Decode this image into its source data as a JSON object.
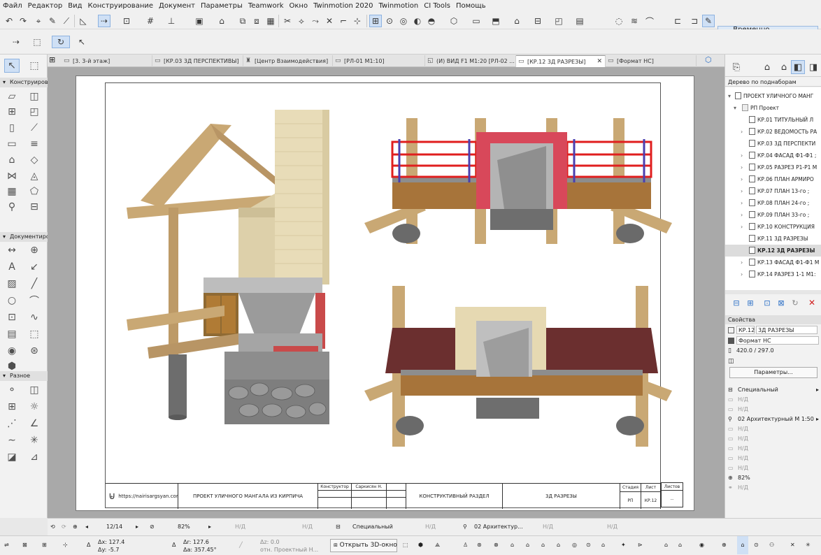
{
  "menu": [
    "Файл",
    "Редактор",
    "Вид",
    "Конструирование",
    "Документ",
    "Параметры",
    "Teamwork",
    "Окно",
    "Twinmotion 2020",
    "Twinmotion",
    "CI Tools",
    "Помощь"
  ],
  "toolbar": {
    "unlock_label": "Временно Разгруппировать"
  },
  "left_palette": {
    "section_construct": "Конструирова",
    "section_document": "Документиро",
    "section_misc": "Разное"
  },
  "tabs": [
    {
      "label": "[3. 3-й этаж]"
    },
    {
      "label": "[КР.03 3Д ПЕРСПЕКТИВЫ]"
    },
    {
      "label": "[Центр Взаимодействия]"
    },
    {
      "label": "[РЛ-01 М1:10]"
    },
    {
      "label": "(И) ВИД F1 М1:20 [РЛ-02 ..."
    },
    {
      "label": "[КР.12 3Д РАЗРЕЗЫ]",
      "close": "✕"
    },
    {
      "label": "[Формат НС]"
    }
  ],
  "title_block": {
    "site": "https://nairisargsyan.com",
    "project": "ПРОЕКТ УЛИЧНОГО МАНГАЛА ИЗ КИРПИЧА",
    "role": "Конструктор",
    "person": "Саркисян Н.",
    "section": "КОНСТРУКТИВНЫЙ РАЗДЕЛ",
    "sheet_title": "3Д РАЗРЕЗЫ",
    "stage_label": "Стадия",
    "stage_value": "РП",
    "sheet_label": "Лист",
    "sheet_value": "КР.12",
    "sheets_label": "Листов",
    "sheets_value": ".."
  },
  "right_panel": {
    "navigator_title": "Дерево по поднаборам",
    "tree": [
      {
        "label": "ПРОЕКТ УЛИЧНОГО МАНГ"
      },
      {
        "label": "РП Проект"
      },
      {
        "label": "КР.01 ТИТУЛЬНЫЙ Л"
      },
      {
        "label": "КР.02 ВЕДОМОСТЬ РА"
      },
      {
        "label": "КР.03 3Д ПЕРСПЕКТИ"
      },
      {
        "label": "КР.04 ФАСАД Ф1-Ф1 ;"
      },
      {
        "label": "КР.05 РАЗРЕЗ Р1-Р1 М"
      },
      {
        "label": "КР.06 ПЛАН АРМИРО"
      },
      {
        "label": "КР.07  ПЛАН 13-го ;"
      },
      {
        "label": "КР.08  ПЛАН 24-го ;"
      },
      {
        "label": "КР.09  ПЛАН 33-го ;"
      },
      {
        "label": "КР.10 КОНСТРУКЦИЯ"
      },
      {
        "label": "КР.11 3Д РАЗРЕЗЫ"
      },
      {
        "label": "КР.12 3Д РАЗРЕЗЫ"
      },
      {
        "label": "КР.13 ФАСАД Ф1-Ф1 М"
      },
      {
        "label": "КР.14 РАЗРЕЗ 1-1 М1:"
      }
    ],
    "properties_title": "Свойства",
    "sheet_id": "КР.12",
    "sheet_name": "3Д РАЗРЕЗЫ",
    "format": "Формат НС",
    "size": "420.0 / 297.0",
    "params_button": "Параметры...",
    "layer_items": [
      "Специальный",
      "Н/Д",
      "Н/Д",
      "02 Архитектурный М 1:50",
      "Н/Д",
      "Н/Д",
      "Н/Д",
      "Н/Д",
      "Н/Д",
      "82%",
      "Н/Д"
    ]
  },
  "status": {
    "page": "12/14",
    "zoom": "82%",
    "nd1": "Н/Д",
    "nd2": "Н/Д",
    "layer": "Специальный",
    "nd3": "Н/Д",
    "scale": "02 Архитектур...",
    "nd4": "Н/Д",
    "nd5": "Н/Д",
    "dx_label": "Δx:",
    "dx": "127.4",
    "dy_label": "Δy:",
    "dy": "-5.7",
    "dr_label": "Δr:",
    "dr": "127.6",
    "da_label": "Δa:",
    "da": "357.45°",
    "dz_label": "Δz:",
    "dz": "0.0",
    "rel": "отн. Проектный Н...",
    "open3d": "Открыть 3D-окно"
  }
}
